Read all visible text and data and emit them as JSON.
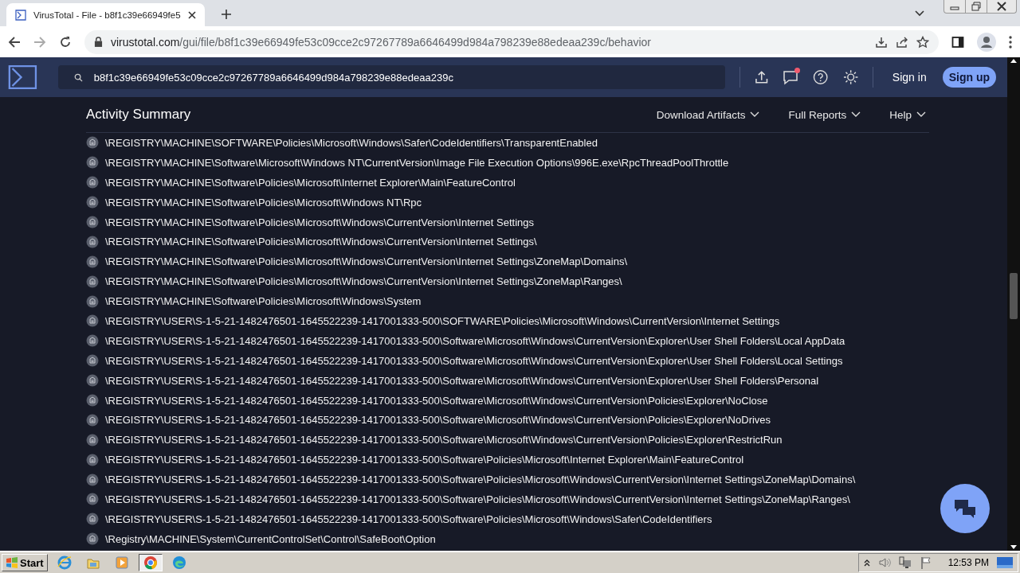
{
  "browser": {
    "tab_title": "VirusTotal - File - b8f1c39e66949fe5",
    "url_host": "virustotal.com",
    "url_path": "/gui/file/b8f1c39e66949fe53c09cce2c97267789a6646499d984a798239e88edeaa239c/behavior"
  },
  "header": {
    "search_value": "b8f1c39e66949fe53c09cce2c97267789a6646499d984a798239e88edeaa239c",
    "notification": true,
    "sign_in": "Sign in",
    "sign_up": "Sign up"
  },
  "section": {
    "title": "Activity Summary",
    "menus": [
      "Download Artifacts",
      "Full Reports",
      "Help"
    ]
  },
  "registry_keys": [
    "\\REGISTRY\\MACHINE\\SOFTWARE\\Policies\\Microsoft\\Windows\\Safer\\CodeIdentifiers\\TransparentEnabled",
    "\\REGISTRY\\MACHINE\\Software\\Microsoft\\Windows NT\\CurrentVersion\\Image File Execution Options\\996E.exe\\RpcThreadPoolThrottle",
    "\\REGISTRY\\MACHINE\\Software\\Policies\\Microsoft\\Internet Explorer\\Main\\FeatureControl",
    "\\REGISTRY\\MACHINE\\Software\\Policies\\Microsoft\\Windows NT\\Rpc",
    "\\REGISTRY\\MACHINE\\Software\\Policies\\Microsoft\\Windows\\CurrentVersion\\Internet Settings",
    "\\REGISTRY\\MACHINE\\Software\\Policies\\Microsoft\\Windows\\CurrentVersion\\Internet Settings\\",
    "\\REGISTRY\\MACHINE\\Software\\Policies\\Microsoft\\Windows\\CurrentVersion\\Internet Settings\\ZoneMap\\Domains\\",
    "\\REGISTRY\\MACHINE\\Software\\Policies\\Microsoft\\Windows\\CurrentVersion\\Internet Settings\\ZoneMap\\Ranges\\",
    "\\REGISTRY\\MACHINE\\Software\\Policies\\Microsoft\\Windows\\System",
    "\\REGISTRY\\USER\\S-1-5-21-1482476501-1645522239-1417001333-500\\SOFTWARE\\Policies\\Microsoft\\Windows\\CurrentVersion\\Internet Settings",
    "\\REGISTRY\\USER\\S-1-5-21-1482476501-1645522239-1417001333-500\\Software\\Microsoft\\Windows\\CurrentVersion\\Explorer\\User Shell Folders\\Local AppData",
    "\\REGISTRY\\USER\\S-1-5-21-1482476501-1645522239-1417001333-500\\Software\\Microsoft\\Windows\\CurrentVersion\\Explorer\\User Shell Folders\\Local Settings",
    "\\REGISTRY\\USER\\S-1-5-21-1482476501-1645522239-1417001333-500\\Software\\Microsoft\\Windows\\CurrentVersion\\Explorer\\User Shell Folders\\Personal",
    "\\REGISTRY\\USER\\S-1-5-21-1482476501-1645522239-1417001333-500\\Software\\Microsoft\\Windows\\CurrentVersion\\Policies\\Explorer\\NoClose",
    "\\REGISTRY\\USER\\S-1-5-21-1482476501-1645522239-1417001333-500\\Software\\Microsoft\\Windows\\CurrentVersion\\Policies\\Explorer\\NoDrives",
    "\\REGISTRY\\USER\\S-1-5-21-1482476501-1645522239-1417001333-500\\Software\\Microsoft\\Windows\\CurrentVersion\\Policies\\Explorer\\RestrictRun",
    "\\REGISTRY\\USER\\S-1-5-21-1482476501-1645522239-1417001333-500\\Software\\Policies\\Microsoft\\Internet Explorer\\Main\\FeatureControl",
    "\\REGISTRY\\USER\\S-1-5-21-1482476501-1645522239-1417001333-500\\Software\\Policies\\Microsoft\\Windows\\CurrentVersion\\Internet Settings\\ZoneMap\\Domains\\",
    "\\REGISTRY\\USER\\S-1-5-21-1482476501-1645522239-1417001333-500\\Software\\Policies\\Microsoft\\Windows\\CurrentVersion\\Internet Settings\\ZoneMap\\Ranges\\",
    "\\REGISTRY\\USER\\S-1-5-21-1482476501-1645522239-1417001333-500\\Software\\Policies\\Microsoft\\Windows\\Safer\\CodeIdentifiers",
    "\\Registry\\MACHINE\\System\\CurrentControlSet\\Control\\SafeBoot\\Option"
  ],
  "taskbar": {
    "start": "Start",
    "apps": [
      {
        "kind": "ie",
        "selected": false
      },
      {
        "kind": "folder",
        "selected": false
      },
      {
        "kind": "media",
        "selected": false
      },
      {
        "kind": "chrome",
        "selected": true
      },
      {
        "kind": "edge",
        "selected": false
      }
    ],
    "clock": "12:53 PM"
  }
}
